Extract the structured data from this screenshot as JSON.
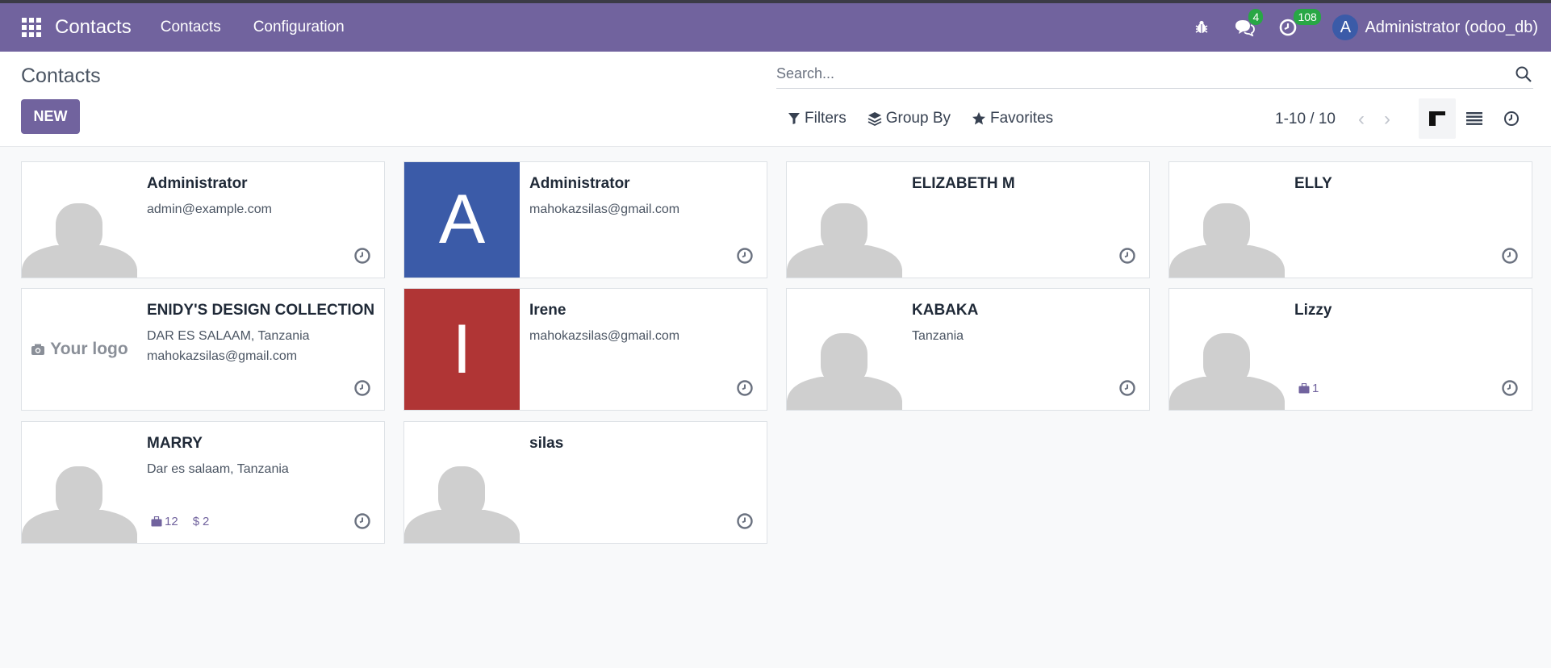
{
  "navbar": {
    "brand": "Contacts",
    "menu": [
      "Contacts",
      "Configuration"
    ],
    "messages_badge": "4",
    "activities_badge": "108",
    "user_initial": "A",
    "user_name": "Administrator (odoo_db)"
  },
  "control_panel": {
    "title": "Contacts",
    "new_button": "NEW",
    "search_placeholder": "Search...",
    "filters": "Filters",
    "group_by": "Group By",
    "favorites": "Favorites",
    "pager": "1-10 / 10"
  },
  "colors": {
    "navbar": "#71639e",
    "avatar_blue": "#3b5ba8",
    "avatar_red": "#b03535",
    "badge_green": "#28a745"
  },
  "cards": [
    {
      "name": "Administrator",
      "lines": [
        "admin@example.com"
      ],
      "image": "placeholder"
    },
    {
      "name": "Administrator",
      "lines": [
        "mahokazsilas@gmail.com"
      ],
      "image": "letter",
      "letter": "A"
    },
    {
      "name": "ELIZABETH M",
      "lines": [],
      "image": "placeholder"
    },
    {
      "name": "ELLY",
      "lines": [],
      "image": "placeholder"
    },
    {
      "name": "ENIDY'S DESIGN COLLECTION",
      "lines": [
        "DAR ES SALAAM, Tanzania",
        "mahokazsilas@gmail.com"
      ],
      "image": "logo",
      "logo_text": "Your logo"
    },
    {
      "name": "Irene",
      "lines": [
        "mahokazsilas@gmail.com"
      ],
      "image": "letter",
      "letter": "I"
    },
    {
      "name": "KABAKA",
      "lines": [
        "Tanzania"
      ],
      "image": "placeholder"
    },
    {
      "name": "Lizzy",
      "lines": [],
      "image": "placeholder",
      "stats": {
        "meetings": "1"
      }
    },
    {
      "name": "MARRY",
      "lines": [
        "Dar es salaam, Tanzania"
      ],
      "image": "placeholder",
      "stats": {
        "meetings": "12",
        "sales": "2"
      }
    },
    {
      "name": "silas",
      "lines": [],
      "image": "placeholder"
    }
  ]
}
